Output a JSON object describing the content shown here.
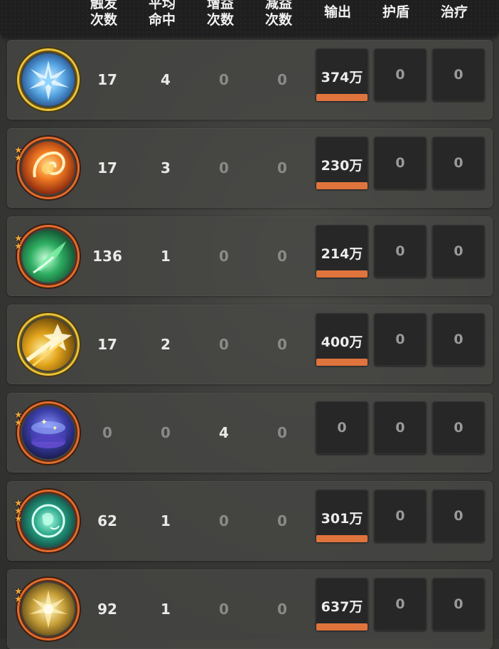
{
  "header": {
    "columns": [
      "触发\n次数",
      "平均\n命中",
      "增益\n次数",
      "减益\n次数",
      "输出",
      "护盾",
      "治疗"
    ]
  },
  "rows": [
    {
      "skill_icon": "ice-shard-skill-icon",
      "ring": "gold",
      "stars": 0,
      "trigger": "17",
      "avg_hit": "4",
      "buff": "0",
      "debuff": "0",
      "output": "374万",
      "output_bar": 1.0,
      "shield": "0",
      "heal": "0"
    },
    {
      "skill_icon": "fire-dragon-skill-icon",
      "ring": "orange",
      "stars": 2,
      "trigger": "17",
      "avg_hit": "3",
      "buff": "0",
      "debuff": "0",
      "output": "230万",
      "output_bar": 1.0,
      "shield": "0",
      "heal": "0"
    },
    {
      "skill_icon": "green-wind-skill-icon",
      "ring": "orange",
      "stars": 2,
      "trigger": "136",
      "avg_hit": "1",
      "buff": "0",
      "debuff": "0",
      "output": "214万",
      "output_bar": 1.0,
      "shield": "0",
      "heal": "0"
    },
    {
      "skill_icon": "golden-slash-skill-icon",
      "ring": "gold",
      "stars": 0,
      "trigger": "17",
      "avg_hit": "2",
      "buff": "0",
      "debuff": "0",
      "output": "400万",
      "output_bar": 1.0,
      "shield": "0",
      "heal": "0"
    },
    {
      "skill_icon": "star-drum-skill-icon",
      "ring": "orange",
      "stars": 2,
      "trigger": "0",
      "avg_hit": "0",
      "buff": "4",
      "debuff": "0",
      "output": "0",
      "output_bar": 0,
      "shield": "0",
      "heal": "0"
    },
    {
      "skill_icon": "jade-orb-skill-icon",
      "ring": "orange",
      "stars": 3,
      "trigger": "62",
      "avg_hit": "1",
      "buff": "0",
      "debuff": "0",
      "output": "301万",
      "output_bar": 1.0,
      "shield": "0",
      "heal": "0"
    },
    {
      "skill_icon": "golden-burst-skill-icon",
      "ring": "orange",
      "stars": 2,
      "trigger": "92",
      "avg_hit": "1",
      "buff": "0",
      "debuff": "0",
      "output": "637万",
      "output_bar": 1.0,
      "shield": "0",
      "heal": "0"
    }
  ],
  "colors": {
    "bar": "#e0743d",
    "ring_orange": "#e26a2c",
    "ring_gold": "#e9c23a",
    "star": "#f0a43a"
  }
}
